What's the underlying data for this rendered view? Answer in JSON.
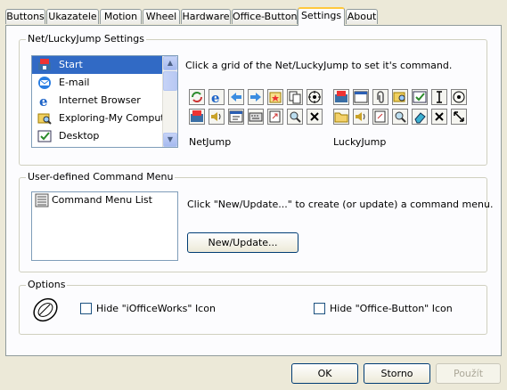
{
  "tabs": [
    "Buttons",
    "Ukazatele",
    "Motion",
    "Wheel",
    "Hardware",
    "Office-Button",
    "Settings",
    "About"
  ],
  "active_tab": "Settings",
  "netlucky": {
    "title": "Net/LuckyJump Settings",
    "items": [
      {
        "label": "Start",
        "icon": "start-icon"
      },
      {
        "label": "E-mail",
        "icon": "email-icon"
      },
      {
        "label": "Internet Browser",
        "icon": "browser-icon"
      },
      {
        "label": "Exploring-My Computer",
        "icon": "explorer-icon"
      },
      {
        "label": "Desktop",
        "icon": "desktop-icon"
      }
    ],
    "instruction": "Click a grid of the Net/LuckyJump to set it's command.",
    "netjump_label": "NetJump",
    "luckyjump_label": "LuckyJump"
  },
  "command_menu": {
    "title": "User-defined Command Menu",
    "list_item": "Command Menu List",
    "instruction": "Click \"New/Update...\" to create (or update) a command menu.",
    "button_label": "New/Update..."
  },
  "options": {
    "title": "Options",
    "hide_ioffice": "Hide \"iOfficeWorks\" Icon",
    "hide_officebutton": "Hide \"Office-Button\" Icon"
  },
  "footer": {
    "ok": "OK",
    "cancel": "Storno",
    "apply": "Použít"
  }
}
